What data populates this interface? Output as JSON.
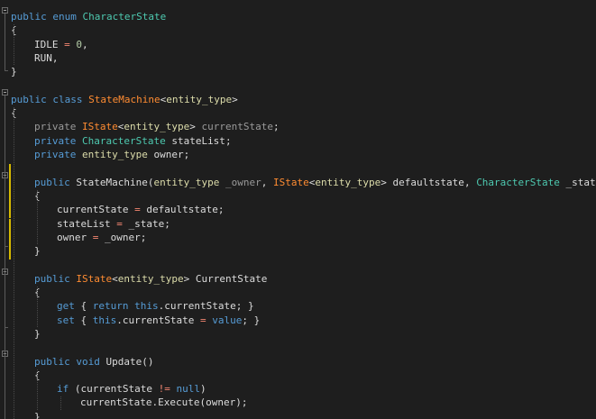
{
  "code": {
    "language": "C#",
    "lines": [
      [
        "public",
        "enum",
        "CharacterState"
      ],
      [
        "{"
      ],
      [
        "IDLE",
        "=",
        "0",
        ","
      ],
      [
        "RUN",
        ","
      ],
      [
        "}"
      ],
      [
        ""
      ],
      [
        "public",
        "class",
        "StateMachine",
        "<",
        "entity_type",
        ">"
      ],
      [
        "{"
      ],
      [
        "private",
        "IState",
        "<",
        "entity_type",
        ">",
        "currentState",
        ";"
      ],
      [
        "private",
        "CharacterState",
        "stateList",
        ";"
      ],
      [
        "private",
        "entity_type",
        "owner",
        ";"
      ],
      [
        ""
      ],
      [
        "public",
        "StateMachine",
        "(",
        "entity_type",
        "_owner",
        ",",
        "IState",
        "<",
        "entity_type",
        ">",
        "defaultstate",
        ",",
        "CharacterState",
        "_state",
        ")"
      ],
      [
        "{"
      ],
      [
        "currentState",
        "=",
        "defaultstate",
        ";"
      ],
      [
        "stateList",
        "=",
        "_state",
        ";"
      ],
      [
        "owner",
        "=",
        "_owner",
        ";"
      ],
      [
        "}"
      ],
      [
        ""
      ],
      [
        "public",
        "IState",
        "<",
        "entity_type",
        ">",
        "CurrentState"
      ],
      [
        "{"
      ],
      [
        "get",
        "{",
        "return",
        "this",
        ".",
        "currentState",
        ";",
        "}"
      ],
      [
        "set",
        "{",
        "this",
        ".",
        "currentState",
        "=",
        "value",
        ";",
        "}"
      ],
      [
        "}"
      ],
      [
        ""
      ],
      [
        "public",
        "void",
        "Update",
        "()"
      ],
      [
        "{"
      ],
      [
        "if",
        "(",
        "currentState",
        "!=",
        "null",
        ")"
      ],
      [
        "currentState",
        ".",
        "Execute",
        "(",
        "owner",
        ");"
      ],
      [
        "}"
      ]
    ]
  },
  "colors": {
    "background": "#1e1e1e",
    "keyword": "#569cd6",
    "type": "#4ec9b0",
    "generic_type": "#ff8c32",
    "type_param": "#dcdcaa",
    "text": "#dcdcdc",
    "operator": "#f48771",
    "number": "#b5cea8",
    "dim": "#9a9a9a"
  }
}
